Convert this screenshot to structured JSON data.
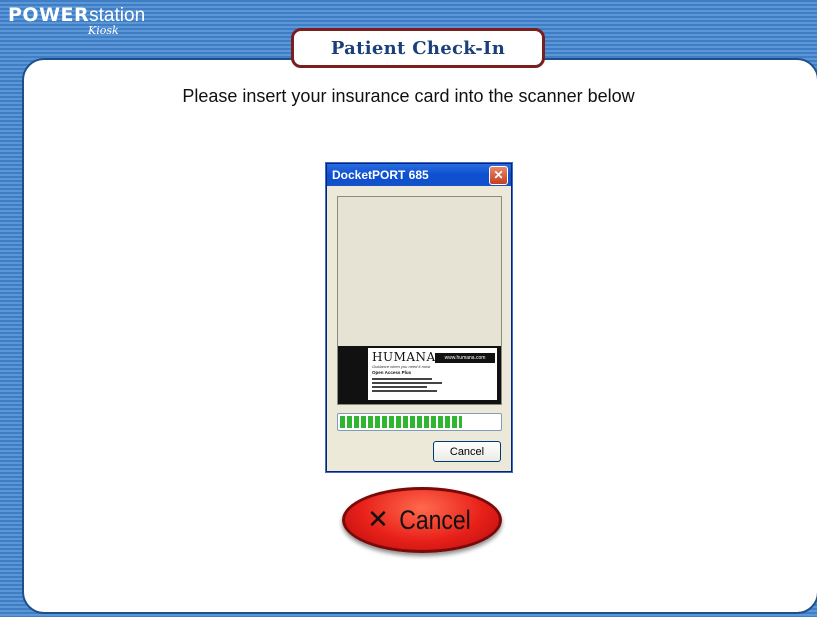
{
  "logo": {
    "power": "POWER",
    "station": "station",
    "kiosk": "Kiosk"
  },
  "header": {
    "title": "Patient Check-In"
  },
  "main": {
    "prompt": "Please insert your insurance card into the scanner below"
  },
  "scanner_dialog": {
    "title": "DocketPORT 685",
    "close_glyph": "✕",
    "card": {
      "brand": "HUMANA.",
      "url": "www.humana.com",
      "tagline": "Guidance when you need it most",
      "plan": "Open Access Plus"
    },
    "progress_fraction": 0.77,
    "cancel_label": "Cancel"
  },
  "kiosk_cancel": {
    "icon": "x-icon",
    "glyph": "✕",
    "label": "Cancel"
  },
  "colors": {
    "frame_blue": "#3f7ec4",
    "title_border": "#7a1f1f",
    "title_text": "#1b3f7a",
    "cancel_red": "#e8211a",
    "progress_green": "#2fb52f"
  }
}
